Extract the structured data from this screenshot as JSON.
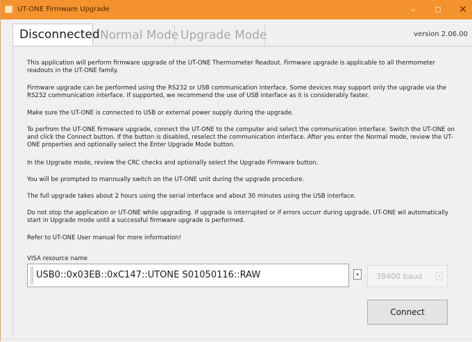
{
  "window": {
    "title": "UT-ONE Firmware Upgrade",
    "icon": "app-icon",
    "controls": {
      "minimize": "–",
      "maximize": "□",
      "close": "✕"
    }
  },
  "tabs": [
    {
      "label": "Disconnected",
      "active": true
    },
    {
      "label": "Normal Mode",
      "active": false
    },
    {
      "label": "Upgrade Mode",
      "active": false
    }
  ],
  "version": "version 2.06.00",
  "paragraphs": [
    "This application will perform firmware upgrade of the UT-ONE Thermometer Readout. Firmware upgrade is applicable to all thermometer readouts in the UT-ONE family.",
    "Firmware upgrade can be performed using the RS232 or USB communication interface. Some devices may support only the upgrade via the RS232 communication interface. If supported, we recommend the use of USB interface as it is considerably faster.",
    "Make sure the UT-ONE is connected to USB or external power supply during the upgrade.",
    "To perfrom the UT-ONE firmware upgrade, connect the UT-ONE to the computer and select the communication interface. Switch the UT-ONE on and click the Connect button. If the button is disabled, reselect the communication interface. After you enter the Normal mode, review the UT-ONE properties and optionally select the Enter Upgrade Mode button.",
    "In the Upgrade mode, review the CRC checks and optionally select the Upgrade Firmware button.",
    "You will be prompted to mannually switch on the UT-ONE unit during the upgrade procedure.",
    "The full upgrade takes about 2 hours using the serial interface and about 30 minutes using the USB interface.",
    "Do not stop the application or UT-ONE while upgrading. If upgrade is interrupted or if errors uccurr during upgrade, UT-ONE wil automatically start in Upgrade mode until a successful firmware upgrade is performed.",
    "Refer to UT-ONE User manual for more information!"
  ],
  "visa": {
    "label": "VISA resource name",
    "value": "USB0::0x03EB::0xC147::UTONE S01050116::RAW"
  },
  "baud": {
    "value": "38400 baud",
    "enabled": false
  },
  "connect_button": "Connect",
  "colors": {
    "titlebar": "#f4922f",
    "panel": "#f0f0f0",
    "disabled_text": "#b8b8b8"
  }
}
